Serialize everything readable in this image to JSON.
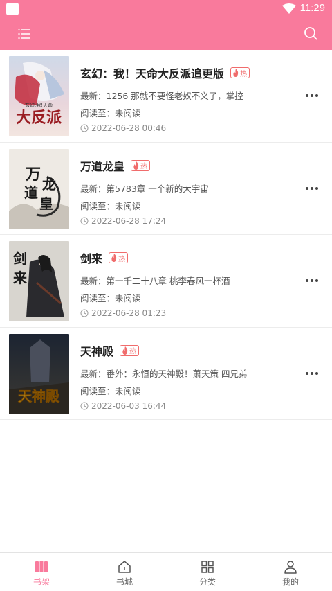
{
  "status_bar": {
    "time": "11:29"
  },
  "header": {
    "menu_icon": "list-icon",
    "search_icon": "search-icon"
  },
  "books": [
    {
      "title": "玄幻：我！天命大反派追更版",
      "hot_label": "热",
      "latest": "最新：1256 那就不要怪老奴不义了，掌控",
      "progress": "阅读至：未阅读",
      "time": "2022-06-28 00:46",
      "cover_text": "大反派",
      "cover_sub": "玄幻:我!天命"
    },
    {
      "title": "万道龙皇",
      "hot_label": "热",
      "latest": "最新：第5783章 一个新的大宇宙",
      "progress": "阅读至：未阅读",
      "time": "2022-06-28 17:24",
      "cover_text": "万道龙皇",
      "cover_sub": ""
    },
    {
      "title": "剑来",
      "hot_label": "热",
      "latest": "最新：第一千二十八章 桃李春风一杯酒",
      "progress": "阅读至：未阅读",
      "time": "2022-06-28 01:23",
      "cover_text": "剑来",
      "cover_sub": ""
    },
    {
      "title": "天神殿",
      "hot_label": "热",
      "latest": "最新：番外：永恒的天神殿！萧天策 四兄弟",
      "progress": "阅读至：未阅读",
      "time": "2022-06-03 16:44",
      "cover_text": "天神殿",
      "cover_sub": ""
    }
  ],
  "tabs": [
    {
      "label": "书架",
      "icon": "bookshelf-icon",
      "active": true
    },
    {
      "label": "书城",
      "icon": "home-icon",
      "active": false
    },
    {
      "label": "分类",
      "icon": "grid-icon",
      "active": false
    },
    {
      "label": "我的",
      "icon": "user-icon",
      "active": false
    }
  ],
  "colors": {
    "accent": "#f97a9c",
    "hot": "#f06c6c"
  }
}
